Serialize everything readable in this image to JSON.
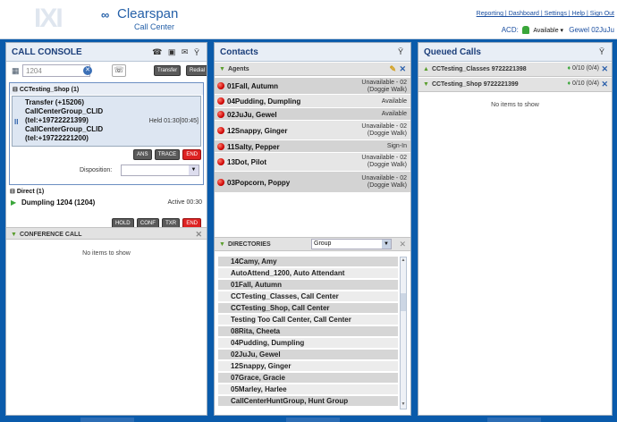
{
  "header": {
    "brand": "Clearspan",
    "subbrand": "Call Center",
    "links": "Reporting | Dashboard | Settings | Help | Sign Out",
    "acd_label": "ACD:",
    "acd_status": "Available ▾",
    "user": "Gewel 02JuJu"
  },
  "console": {
    "title": "CALL CONSOLE",
    "dial_value": "1204",
    "transfer_label": "Transfer",
    "redial_label": "Redial",
    "queue_group": "CCTesting_Shop (1)",
    "call_lines": [
      "Transfer (+15206)",
      "CallCenterGroup_CLID",
      "(tel:+19722221399)",
      "CallCenterGroup_CLID",
      "(tel:+19722221200)"
    ],
    "held_status": "Held 01:30[00:45]",
    "ans_label": "ANS",
    "trace_label": "TRACE",
    "end_label": "END",
    "disposition_label": "Disposition:",
    "direct_group": "Direct (1)",
    "direct_call": "Dumpling 1204 (1204)",
    "direct_status": "Active 00:30",
    "hold_label": "HOLD",
    "conf_label": "CONF",
    "txr_label": "TXR",
    "conference_title": "CONFERENCE CALL",
    "conference_empty": "No items to show"
  },
  "contacts": {
    "title": "Contacts",
    "agents_title": "Agents",
    "agents": [
      {
        "name": "01Fall, Autumn",
        "status": "Unavailable - 02",
        "status2": "(Doggie Walk)"
      },
      {
        "name": "04Pudding, Dumpling",
        "status": "Available",
        "status2": ""
      },
      {
        "name": "02JuJu, Gewel",
        "status": "Available",
        "status2": ""
      },
      {
        "name": "12Snappy, Ginger",
        "status": "Unavailable - 02",
        "status2": "(Doggie Walk)"
      },
      {
        "name": "11Salty, Pepper",
        "status": "Sign-In",
        "status2": ""
      },
      {
        "name": "13Dot, Pilot",
        "status": "Unavailable - 02",
        "status2": "(Doggie Walk)"
      },
      {
        "name": "03Popcorn, Poppy",
        "status": "Unavailable - 02",
        "status2": "(Doggie Walk)"
      }
    ],
    "directories_title": "DIRECTORIES",
    "directory_select": "Group",
    "directory_items": [
      "14Camy, Amy",
      "AutoAttend_1200, Auto Attendant",
      "01Fall, Autumn",
      "CCTesting_Classes, Call Center",
      "CCTesting_Shop, Call Center",
      "Testing Too Call Center, Call Center",
      "08Rita, Cheeta",
      "04Pudding, Dumpling",
      "02JuJu, Gewel",
      "12Snappy, Ginger",
      "07Grace, Gracie",
      "05Marley, Harlee",
      "CallCenterHuntGroup, Hunt Group"
    ]
  },
  "queued": {
    "title": "Queued Calls",
    "queues": [
      {
        "name": "CCTesting_Classes 9722221398",
        "count": "0/10 (0/4)"
      },
      {
        "name": "CCTesting_Shop 9722221399",
        "count": "0/10 (0/4)"
      }
    ],
    "empty": "No items to show"
  },
  "colors": {
    "accent": "#0a5bab",
    "title": "#1b3e7a",
    "end": "#d22222",
    "available": "#3aa63a"
  }
}
